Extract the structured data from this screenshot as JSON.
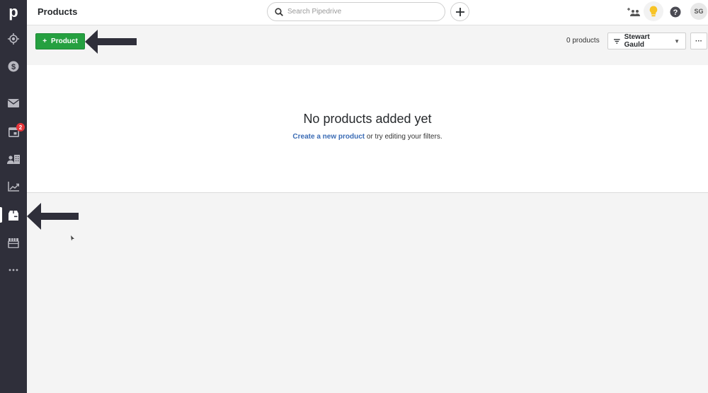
{
  "sidebar": {
    "logo": "p",
    "items": [
      {
        "name": "leads",
        "icon": "target-icon"
      },
      {
        "name": "deals",
        "icon": "dollar-icon"
      },
      {
        "name": "mail",
        "icon": "mail-icon"
      },
      {
        "name": "activities",
        "icon": "calendar-icon",
        "badge": "2"
      },
      {
        "name": "contacts",
        "icon": "contacts-icon"
      },
      {
        "name": "insights",
        "icon": "chart-icon"
      },
      {
        "name": "products",
        "icon": "box-icon",
        "active": true
      },
      {
        "name": "marketplace",
        "icon": "store-icon"
      },
      {
        "name": "more",
        "icon": "more-icon"
      }
    ]
  },
  "header": {
    "title": "Products",
    "search_placeholder": "Search Pipedrive",
    "avatar_initials": "SG"
  },
  "actions": {
    "add_product_label": "Product",
    "count_label": "0 products",
    "filter_label": "Stewart Gauld",
    "more_label": "···"
  },
  "empty_state": {
    "title": "No products added yet",
    "link_text": "Create a new product",
    "rest_text": " or try editing your filters."
  },
  "colors": {
    "accent_green": "#25a040",
    "link_blue": "#3b6cb5",
    "sidebar_bg": "#2f2f3a",
    "badge_red": "#e6353a",
    "bulb_yellow": "#f7c325"
  }
}
